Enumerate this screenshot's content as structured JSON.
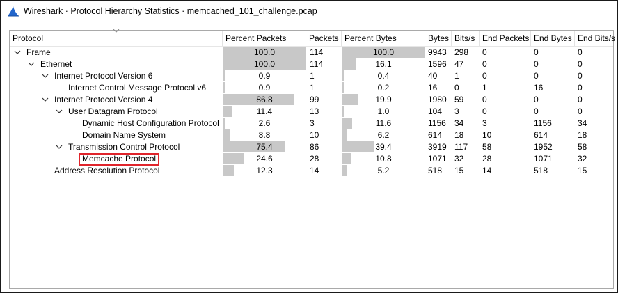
{
  "window": {
    "title": "Wireshark · Protocol Hierarchy Statistics · memcached_101_challenge.pcap",
    "icon": "wireshark-fin-icon",
    "accent": "#2266cc"
  },
  "table": {
    "columns": [
      "Protocol",
      "Percent Packets",
      "Packets",
      "Percent Bytes",
      "Bytes",
      "Bits/s",
      "End Packets",
      "End Bytes",
      "End Bits/s"
    ],
    "highlight_color": "#e0242b",
    "bar_color": "#c8c8c8",
    "rows": [
      {
        "protocol": "Frame",
        "expanded": true,
        "percent_packets": "100.0",
        "percent_packets_fraction": 1.0,
        "packets": "114",
        "percent_bytes": "100.0",
        "percent_bytes_fraction": 1.0,
        "bytes": "9943",
        "bits_s": "298",
        "end_packets": "0",
        "end_bytes": "0",
        "end_bits_s": "0"
      },
      {
        "protocol": "Ethernet",
        "expanded": true,
        "percent_packets": "100.0",
        "percent_packets_fraction": 1.0,
        "packets": "114",
        "percent_bytes": "16.1",
        "percent_bytes_fraction": 0.161,
        "bytes": "1596",
        "bits_s": "47",
        "end_packets": "0",
        "end_bytes": "0",
        "end_bits_s": "0"
      },
      {
        "protocol": "Internet Protocol Version 6",
        "expanded": true,
        "percent_packets": "0.9",
        "percent_packets_fraction": 0.009,
        "packets": "1",
        "percent_bytes": "0.4",
        "percent_bytes_fraction": 0.004,
        "bytes": "40",
        "bits_s": "1",
        "end_packets": "0",
        "end_bytes": "0",
        "end_bits_s": "0"
      },
      {
        "protocol": "Internet Control Message Protocol v6",
        "expanded": null,
        "percent_packets": "0.9",
        "percent_packets_fraction": 0.009,
        "packets": "1",
        "percent_bytes": "0.2",
        "percent_bytes_fraction": 0.002,
        "bytes": "16",
        "bits_s": "0",
        "end_packets": "1",
        "end_bytes": "16",
        "end_bits_s": "0"
      },
      {
        "protocol": "Internet Protocol Version 4",
        "expanded": true,
        "percent_packets": "86.8",
        "percent_packets_fraction": 0.868,
        "packets": "99",
        "percent_bytes": "19.9",
        "percent_bytes_fraction": 0.199,
        "bytes": "1980",
        "bits_s": "59",
        "end_packets": "0",
        "end_bytes": "0",
        "end_bits_s": "0"
      },
      {
        "protocol": "User Datagram Protocol",
        "expanded": true,
        "percent_packets": "11.4",
        "percent_packets_fraction": 0.114,
        "packets": "13",
        "percent_bytes": "1.0",
        "percent_bytes_fraction": 0.01,
        "bytes": "104",
        "bits_s": "3",
        "end_packets": "0",
        "end_bytes": "0",
        "end_bits_s": "0"
      },
      {
        "protocol": "Dynamic Host Configuration Protocol",
        "expanded": null,
        "percent_packets": "2.6",
        "percent_packets_fraction": 0.026,
        "packets": "3",
        "percent_bytes": "11.6",
        "percent_bytes_fraction": 0.116,
        "bytes": "1156",
        "bits_s": "34",
        "end_packets": "3",
        "end_bytes": "1156",
        "end_bits_s": "34"
      },
      {
        "protocol": "Domain Name System",
        "expanded": null,
        "percent_packets": "8.8",
        "percent_packets_fraction": 0.088,
        "packets": "10",
        "percent_bytes": "6.2",
        "percent_bytes_fraction": 0.062,
        "bytes": "614",
        "bits_s": "18",
        "end_packets": "10",
        "end_bytes": "614",
        "end_bits_s": "18"
      },
      {
        "protocol": "Transmission Control Protocol",
        "expanded": true,
        "percent_packets": "75.4",
        "percent_packets_fraction": 0.754,
        "packets": "86",
        "percent_bytes": "39.4",
        "percent_bytes_fraction": 0.394,
        "bytes": "3919",
        "bits_s": "117",
        "end_packets": "58",
        "end_bytes": "1952",
        "end_bits_s": "58"
      },
      {
        "protocol": "Memcache Protocol",
        "expanded": null,
        "highlighted": true,
        "percent_packets": "24.6",
        "percent_packets_fraction": 0.246,
        "packets": "28",
        "percent_bytes": "10.8",
        "percent_bytes_fraction": 0.108,
        "bytes": "1071",
        "bits_s": "32",
        "end_packets": "28",
        "end_bytes": "1071",
        "end_bits_s": "32"
      },
      {
        "protocol": "Address Resolution Protocol",
        "expanded": null,
        "percent_packets": "12.3",
        "percent_packets_fraction": 0.123,
        "packets": "14",
        "percent_bytes": "5.2",
        "percent_bytes_fraction": 0.052,
        "bytes": "518",
        "bits_s": "15",
        "end_packets": "14",
        "end_bytes": "518",
        "end_bits_s": "15"
      }
    ]
  }
}
